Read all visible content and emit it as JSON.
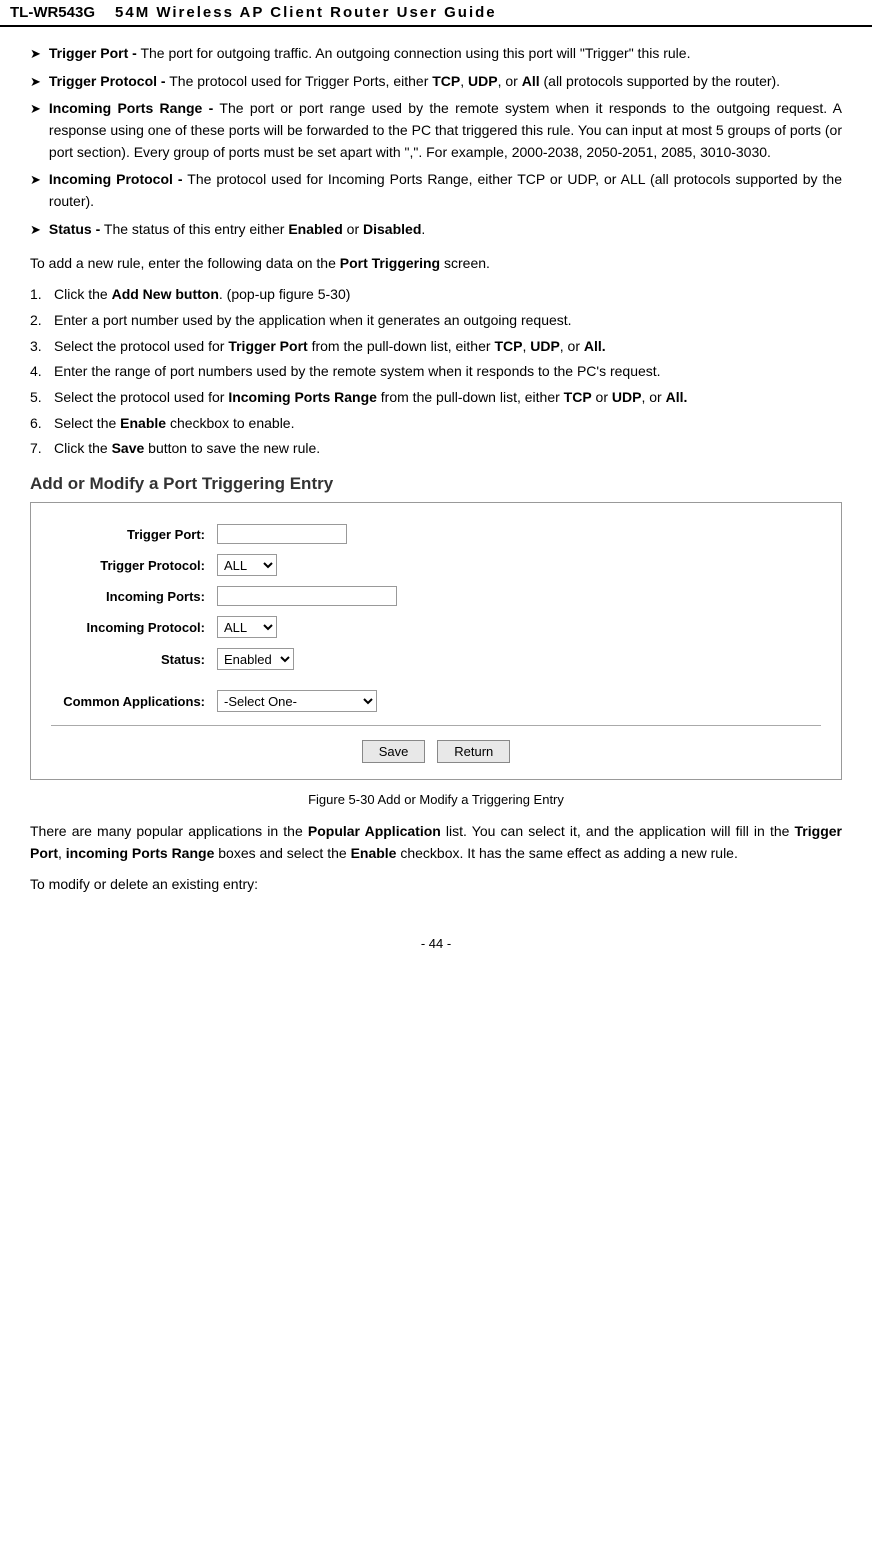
{
  "header": {
    "model": "TL-WR543G",
    "subtitle": "54M  Wireless  AP  Client  Router  User  Guide"
  },
  "bullets": [
    {
      "label": "Trigger Port -",
      "text": "The port for outgoing traffic. An outgoing connection using this port will \"Trigger\" this rule."
    },
    {
      "label": "Trigger Protocol -",
      "text": "The protocol used for Trigger Ports, either TCP, UDP, or All (all protocols supported by the router)."
    },
    {
      "label": "Incoming Ports Range -",
      "text": "The port or port range used by the remote system when it responds to the outgoing request. A response using one of these ports will be forwarded to the PC that triggered this rule. You can input at most 5 groups of ports (or port section). Every group of ports must be set apart with \",\". For example, 2000-2038, 2050-2051, 2085, 3010-3030."
    },
    {
      "label": "Incoming Protocol -",
      "text": "The protocol used for Incoming Ports Range, either TCP or UDP, or ALL (all protocols supported by the router)."
    },
    {
      "label": "Status -",
      "text": "The status of this entry either Enabled or Disabled."
    }
  ],
  "para1": "To add a new rule, enter the following data on the Port Triggering screen.",
  "steps": [
    {
      "num": "1.",
      "text": "Click the Add New button. (pop-up figure 5-30)"
    },
    {
      "num": "2.",
      "text": "Enter a port number used by the application when it generates an outgoing request."
    },
    {
      "num": "3.",
      "text": "Select the protocol used for Trigger Port from the pull-down list, either TCP, UDP, or All."
    },
    {
      "num": "4.",
      "text": "Enter the range of port numbers used by the remote system when it responds to the PC's request."
    },
    {
      "num": "5.",
      "text": "Select the protocol used for Incoming Ports Range from the pull-down list, either TCP or UDP, or All."
    },
    {
      "num": "6.",
      "text": "Select the Enable checkbox to enable."
    },
    {
      "num": "7.",
      "text": "Click the Save button to save the new rule."
    }
  ],
  "section_title": "Add or Modify a Port Triggering Entry",
  "form": {
    "trigger_port_label": "Trigger Port:",
    "trigger_protocol_label": "Trigger Protocol:",
    "trigger_protocol_value": "ALL",
    "incoming_ports_label": "Incoming Ports:",
    "incoming_protocol_label": "Incoming Protocol:",
    "incoming_protocol_value": "ALL",
    "status_label": "Status:",
    "status_value": "Enabled",
    "common_apps_label": "Common Applications:",
    "common_apps_value": "-Select One-",
    "save_button": "Save",
    "return_button": "Return"
  },
  "figure_caption": "Figure 5-30    Add or Modify a Triggering Entry",
  "para2_parts": [
    {
      "text": "There are many popular applications in the "
    },
    {
      "text": "Popular Application",
      "bold": true
    },
    {
      "text": " list. You can select it, and the application will fill in the "
    },
    {
      "text": "Trigger Port",
      "bold": true
    },
    {
      "text": ", "
    },
    {
      "text": "incoming Ports Range",
      "bold": true
    },
    {
      "text": " boxes and select the "
    },
    {
      "text": "Enable",
      "bold": true
    },
    {
      "text": " checkbox. It has the same effect as adding a new rule."
    }
  ],
  "para3": "To modify or delete an existing entry:",
  "page_num": "- 44 -"
}
